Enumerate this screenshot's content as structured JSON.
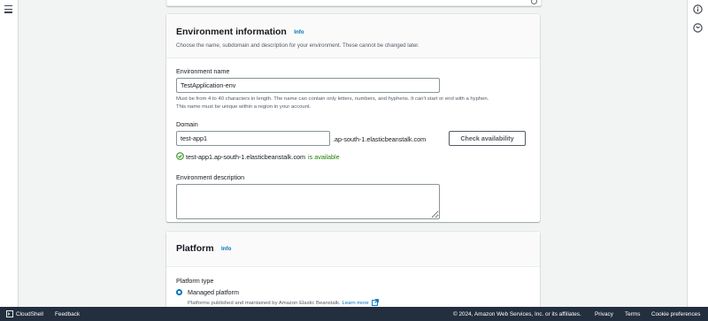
{
  "env_card": {
    "title": "Environment information",
    "info": "Info",
    "description": "Choose the name, subdomain and description for your environment. These cannot be changed later.",
    "name_label": "Environment name",
    "name_value": "TestApplication-env",
    "name_hint_1": "Must be from 4 to 40 characters in length. The name can contain only letters, numbers, and hyphens. It can't start or end with a hyphen.",
    "name_hint_2": "This name must be unique within a region in your account.",
    "domain_label": "Domain",
    "domain_value": "test-app1",
    "domain_suffix": ".ap-south-1.elasticbeanstalk.com",
    "check_button": "Check availability",
    "availability_domain": "test-app1.ap-south-1.elasticbeanstalk.com",
    "availability_status": "is available",
    "desc_label": "Environment description",
    "desc_value": ""
  },
  "platform_card": {
    "title": "Platform",
    "info": "Info",
    "type_label": "Platform type",
    "option_managed": "Managed platform",
    "option_managed_desc": "Platforms published and maintained by Amazon Elastic Beanstalk.",
    "learn_more": "Learn more"
  },
  "footer": {
    "cloudshell": "CloudShell",
    "feedback": "Feedback",
    "copyright": "© 2024, Amazon Web Services, Inc. or its affiliates.",
    "privacy": "Privacy",
    "terms": "Terms",
    "cookies": "Cookie preferences"
  },
  "icons": {
    "menu": "hamburger-menu-icon",
    "info": "info-circle-icon",
    "history": "clock-history-icon",
    "success": "check-circle-icon",
    "external": "external-link-icon",
    "cloudshell": "terminal-icon"
  },
  "colors": {
    "link": "#0073bb",
    "success": "#1d8102",
    "footer_bg": "#232f3e"
  }
}
